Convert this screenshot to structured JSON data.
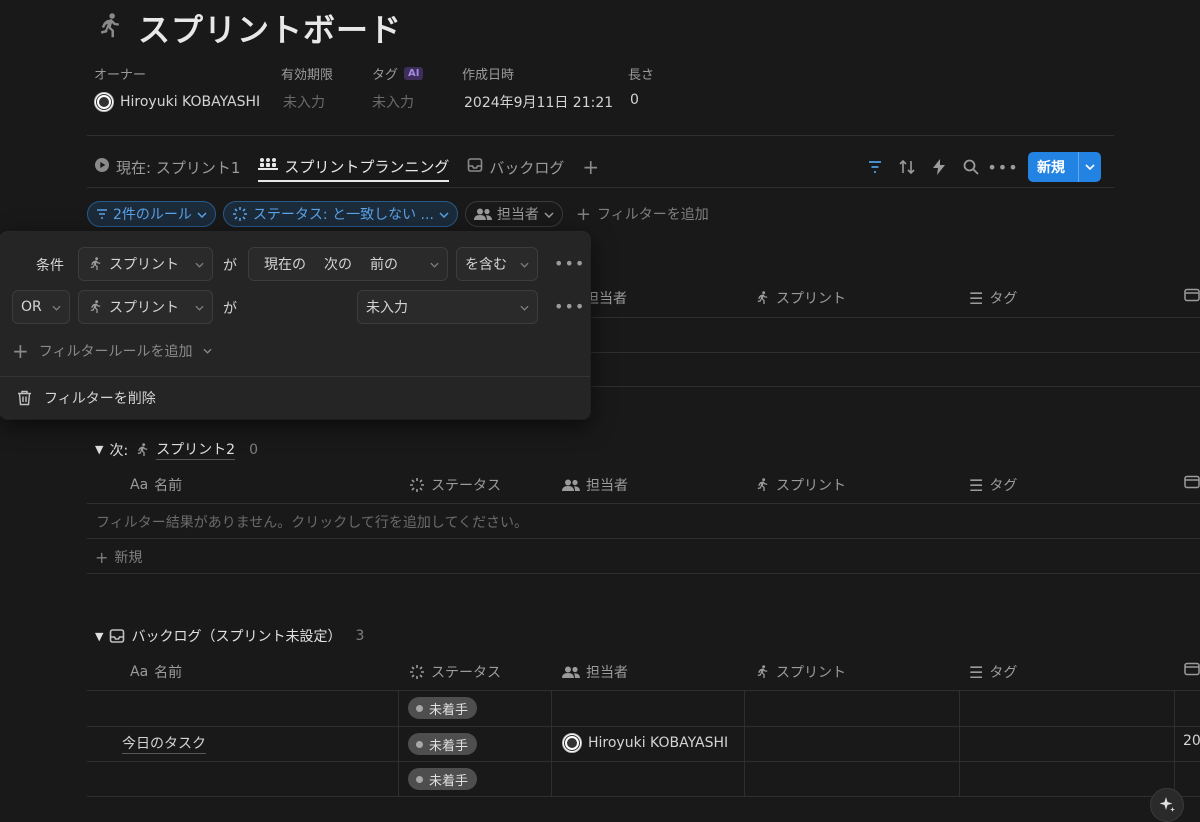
{
  "page": {
    "title": "スプリントボード"
  },
  "properties": {
    "owner_label": "オーナー",
    "owner_value": "Hiroyuki KOBAYASHI",
    "expiry_label": "有効期限",
    "expiry_value": "未入力",
    "tag_label": "タグ",
    "tag_ai_badge": "AI",
    "tag_value": "未入力",
    "created_label": "作成日時",
    "created_value": "2024年9月11日 21:21",
    "length_label": "長さ",
    "length_value": "0"
  },
  "tabs": [
    {
      "label": "現在: スプリント1",
      "icon": "play-circle-icon",
      "active": false
    },
    {
      "label": "スプリントプランニング",
      "icon": "people-board-icon",
      "active": true
    },
    {
      "label": "バックログ",
      "icon": "inbox-tray-icon",
      "active": false
    }
  ],
  "toolbar": {
    "new_label": "新規"
  },
  "filters": {
    "rules_chip": "2件のルール",
    "status_chip": "ステータス: と一致しない ...",
    "assignee_chip": "担当者",
    "add_filter": "フィルターを追加"
  },
  "popup": {
    "row1_prefix": "条件",
    "row1_property": "スプリント",
    "row1_connector": "が",
    "row1_values": [
      "現在の",
      "次の",
      "前の"
    ],
    "row1_operator": "を含む",
    "row2_prefix": "OR",
    "row2_property": "スプリント",
    "row2_connector": "が",
    "row2_value": "未入力",
    "add_rule": "フィルタールールを追加",
    "delete_filter": "フィルターを削除"
  },
  "columns": {
    "name": "名前",
    "name_prefix": "Aa",
    "status": "ステータス",
    "assignee": "担当者",
    "sprint": "スプリント",
    "tag": "タグ"
  },
  "groups": {
    "next": {
      "prefix": "次:",
      "label": "スプリント2",
      "count": "0",
      "empty_message": "フィルター結果がありません。クリックして行を追加してください。",
      "new_row": "新規"
    },
    "backlog": {
      "label": "バックログ（スプリント未設定）",
      "count": "3",
      "rows": [
        {
          "name": "",
          "status": "未着手",
          "assignee": "",
          "date_fragment": ""
        },
        {
          "name": "今日のタスク",
          "status": "未着手",
          "assignee": "Hiroyuki KOBAYASHI",
          "date_fragment": "20"
        },
        {
          "name": "",
          "status": "未着手",
          "assignee": "",
          "date_fragment": ""
        }
      ]
    }
  },
  "colors": {
    "background": "#191919",
    "accent_blue": "#2383e2",
    "filter_blue": "#5aa2e8",
    "status_pill": "#4e4e4e"
  }
}
